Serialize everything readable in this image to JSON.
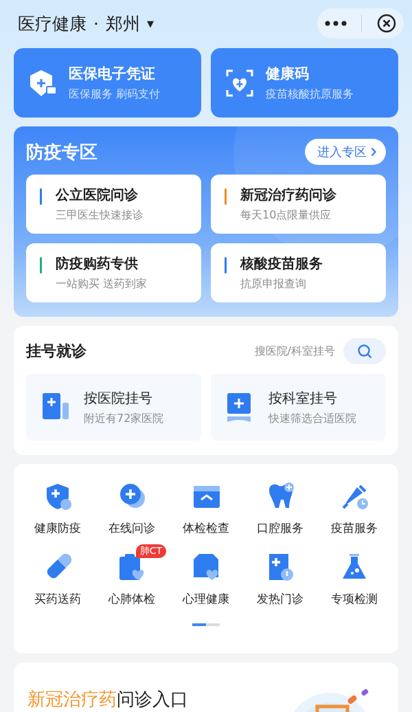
{
  "header": {
    "title": "医疗健康",
    "separator": "·",
    "city": "郑州",
    "caret": "▼"
  },
  "top_cards": [
    {
      "title": "医保电子凭证",
      "subtitle": "医保服务 刷码支付"
    },
    {
      "title": "健康码",
      "subtitle": "疫苗核酸抗原服务"
    }
  ],
  "epidemic": {
    "title": "防疫专区",
    "button": "进入专区",
    "items": [
      {
        "title": "公立医院问诊",
        "subtitle": "三甲医生快速接诊",
        "color": "#2f7cf0"
      },
      {
        "title": "新冠治疗药问诊",
        "subtitle": "每天10点限量供应",
        "color": "#f08a24"
      },
      {
        "title": "防疫购药专供",
        "subtitle": "一站购买 送药到家",
        "color": "#1fb07a"
      },
      {
        "title": "核酸疫苗服务",
        "subtitle": "抗原申报查询",
        "color": "#2f7cf0"
      }
    ]
  },
  "registration": {
    "title": "挂号就诊",
    "search_placeholder": "搜医院/科室挂号",
    "options": [
      {
        "title": "按医院挂号",
        "subtitle": "附近有72家医院"
      },
      {
        "title": "按科室挂号",
        "subtitle": "快速筛选合适医院"
      }
    ]
  },
  "services": [
    {
      "label": "健康防疫"
    },
    {
      "label": "在线问诊"
    },
    {
      "label": "体检检查"
    },
    {
      "label": "口腔服务"
    },
    {
      "label": "疫苗服务"
    },
    {
      "label": "买药送药"
    },
    {
      "label": "心肺体检",
      "badge": "肺CT"
    },
    {
      "label": "心理健康"
    },
    {
      "label": "发热门诊"
    },
    {
      "label": "专项检测"
    }
  ],
  "pager": [
    {
      "selected": true
    },
    {
      "selected": false
    }
  ],
  "banner": {
    "highlight": "新冠治疗药",
    "rest": "问诊入口"
  }
}
